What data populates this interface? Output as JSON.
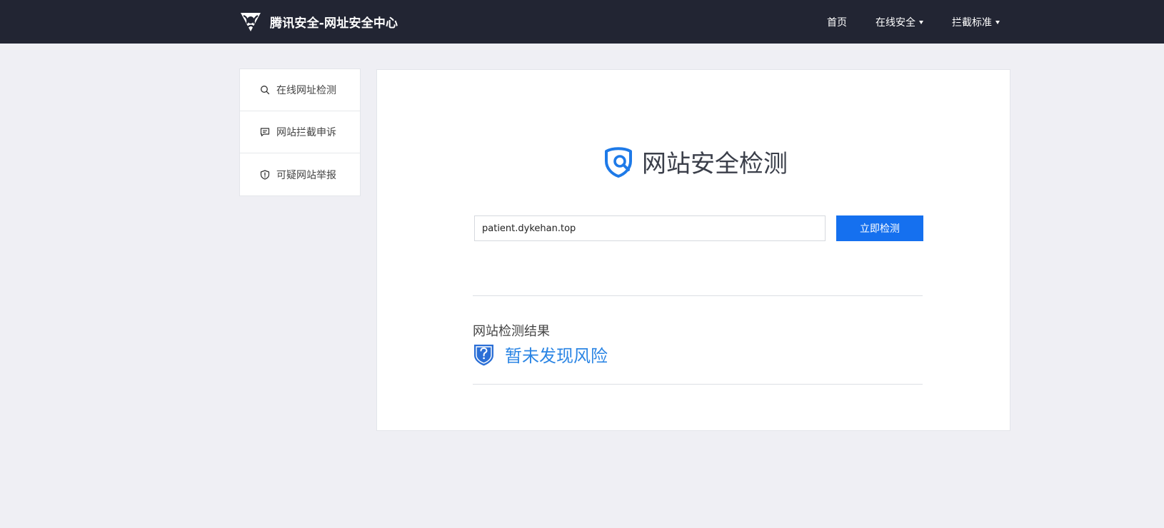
{
  "header": {
    "brand_title": "腾讯安全-网址安全中心",
    "nav": [
      {
        "label": "首页",
        "has_dropdown": false
      },
      {
        "label": "在线安全",
        "has_dropdown": true
      },
      {
        "label": "拦截标准",
        "has_dropdown": true
      }
    ]
  },
  "sidebar": {
    "items": [
      {
        "label": "在线网址检测",
        "icon": "search-icon"
      },
      {
        "label": "网站拦截申诉",
        "icon": "chat-icon"
      },
      {
        "label": "可疑网站举报",
        "icon": "shield-alert-icon"
      }
    ]
  },
  "main": {
    "title": "网站安全检测",
    "search": {
      "value": "patient.dykehan.top",
      "button_label": "立即检测"
    },
    "result": {
      "label": "网站检测结果",
      "status": "暂未发现风险"
    }
  },
  "colors": {
    "header_bg": "#222533",
    "page_bg": "#efeff4",
    "accent": "#1570ef",
    "result_text": "#2b85e4"
  }
}
